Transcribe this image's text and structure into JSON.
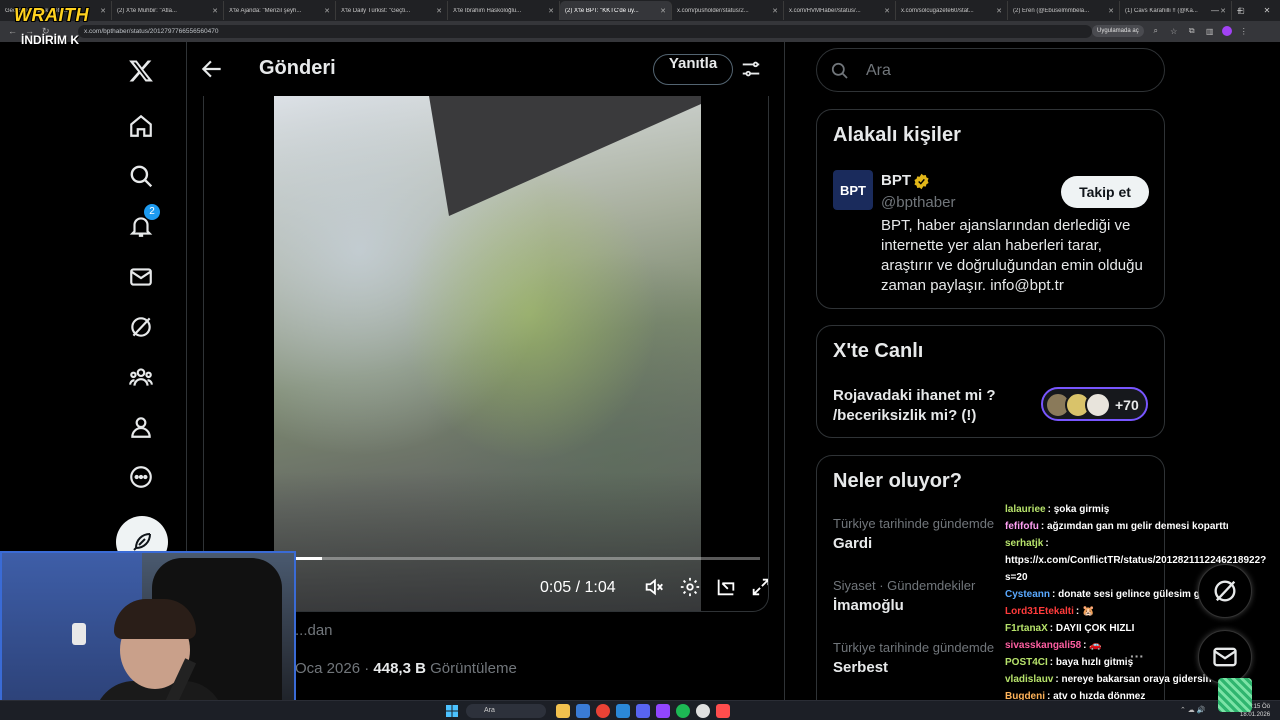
{
  "browser": {
    "tabs": [
      {
        "label": "GeoGuessr Link Detector",
        "active": false
      },
      {
        "label": "(2) X'te Muhbir: \"Atla...",
        "active": false
      },
      {
        "label": "X'te Ajanda: \"Menzil şeyh...",
        "active": false
      },
      {
        "label": "X'te Daily Türkist: \"Geçti...",
        "active": false
      },
      {
        "label": "X'te İbrahim Haskoloğlu...",
        "active": false
      },
      {
        "label": "(2) X'te BPT: \"KKTC'de uy...",
        "active": true
      },
      {
        "label": "x.com/pusholder/status/2...",
        "active": false
      },
      {
        "label": "x.com/HVMHaber/status/...",
        "active": false
      },
      {
        "label": "x.com/solcugazete60/stat...",
        "active": false
      },
      {
        "label": "(2) Eren (@Ebuselmmbela...",
        "active": false
      },
      {
        "label": "(1) Cavs Karahilli !! (@Ka...",
        "active": false
      }
    ],
    "url": "x.com/bpthaber/status/2012797766556560470",
    "app_pill": "Uygulamada aç"
  },
  "overlay": {
    "brand": "WRAITH",
    "promo": "İNDİRİM K"
  },
  "nav": {
    "notifications_badge": "2",
    "items": [
      "x-logo-icon",
      "home-icon",
      "search-icon",
      "bell-icon",
      "mail-icon",
      "grok-icon",
      "communities-icon",
      "profile-icon",
      "more-icon"
    ]
  },
  "post": {
    "header_title": "Gönderi",
    "reply_label": "Yanıtla",
    "video": {
      "current_time": "0:05",
      "duration": "1:04",
      "progress": 0.08
    },
    "source_text": "...dan",
    "date": "Oca 2026",
    "separator": "·",
    "views": "448,3 B",
    "views_label": "Görüntüleme"
  },
  "sidebar": {
    "search_placeholder": "Ara",
    "related": {
      "title": "Alakalı kişiler",
      "logo_text": "BPT",
      "name": "BPT",
      "handle": "@bpthaber",
      "follow_label": "Takip et",
      "bio": "BPT, haber ajanslarından derlediği ve internette yer alan haberleri tarar, araştırır ve doğruluğundan emin olduğu zaman paylaşır. info@bpt.tr"
    },
    "live": {
      "title": "X'te Canlı",
      "topic": "Rojavadaki ihanet mi ? /beceriksizlik mi? (!)",
      "count": "+70"
    },
    "trends": {
      "title": "Neler oluyor?",
      "items": [
        {
          "category": "Türkiye tarihinde gündemde",
          "name": "Gardi"
        },
        {
          "category": "Siyaset · Gündemdekiler",
          "name": "İmamoğlu"
        },
        {
          "category": "Türkiye tarihinde gündemde",
          "name": "Serbest"
        }
      ]
    }
  },
  "chat": [
    {
      "user": "lalauriee",
      "color": "#b7e36b",
      "msg": ": şoka girmiş"
    },
    {
      "user": "fefifofu",
      "color": "#ff9ff3",
      "msg": ": ağzımdan gan mı gelir demesi koparttı"
    },
    {
      "user": "serhatjk",
      "color": "#b7e36b",
      "msg": ": https://x.com/ConflictTR/status/2012821112246218922?s=20"
    },
    {
      "user": "Cysteann",
      "color": "#5aa9ff",
      "msg": ": donate sesi gelince gülesim geliyo"
    },
    {
      "user": "Lord31Etekalti",
      "color": "#ff3b3b",
      "msg": ": 🐹"
    },
    {
      "user": "F1rtanaX",
      "color": "#b7e36b",
      "msg": ": DAYII ÇOK HIZLI"
    },
    {
      "user": "sivasskangali58",
      "color": "#ff5fa2",
      "msg": ": 🚗"
    },
    {
      "user": "POST4CI",
      "color": "#b7e36b",
      "msg": ": baya hızlı gitmiş"
    },
    {
      "user": "vladislauv",
      "color": "#b7e36b",
      "msg": ": nereye bakarsan oraya gidersin"
    },
    {
      "user": "Bugdeni",
      "color": "#ffb35a",
      "msg": ": atv o hızda dönmez"
    }
  ],
  "taskbar": {
    "search": "Ara",
    "time": "20:15 Öö",
    "date": "18.01.2026"
  }
}
